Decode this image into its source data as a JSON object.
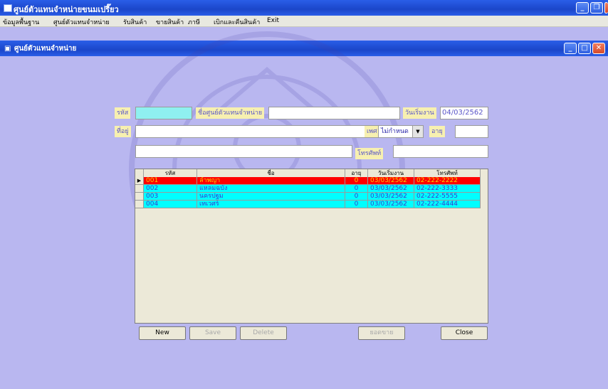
{
  "app": {
    "title": "ศูนย์ตัวแทนจำหน่ายขนมเปรี๊ยว"
  },
  "menu": [
    "ข้อมูลพื้นฐาน",
    "ศูนย์ตัวแทนจำหน่าย",
    "รับสินค้า",
    "ขายสินค้า",
    "ภาษี",
    "เบิกและคืนสินค้า",
    "Exit"
  ],
  "child_window": {
    "title": "ศูนย์ตัวแทนจำหน่าย"
  },
  "form": {
    "code_label": "รหัส",
    "code_value": "",
    "name_label": "ชื่อศูนย์ตัวแทนจำหน่าย",
    "name_value": "",
    "start_label": "วันเริ่มงาน",
    "start_value": "04/03/2562",
    "address_label": "ที่อยู่",
    "address_value": "",
    "address2_value": "",
    "gender_label": "เพศ",
    "gender_value": "ไม่กำหนด",
    "age_label": "อายุ",
    "age_value": "",
    "phone_label": "โทรศัพท์",
    "phone_value": ""
  },
  "grid": {
    "headers": [
      "รหัส",
      "ชื่อ",
      "อายุ",
      "วันเริ่มงาน",
      "โทรศัพท์"
    ],
    "rows": [
      {
        "code": "001",
        "name": "ลำพญา",
        "age": "0",
        "start": "03/03/2562",
        "phone": "02-222-2222"
      },
      {
        "code": "002",
        "name": "แหลมฉบัง",
        "age": "0",
        "start": "03/03/2562",
        "phone": "02-222-3333"
      },
      {
        "code": "003",
        "name": "นครปฐม",
        "age": "0",
        "start": "03/03/2562",
        "phone": "02-222-5555"
      },
      {
        "code": "004",
        "name": "เทเวศร์",
        "age": "0",
        "start": "03/03/2562",
        "phone": "02-222-4444"
      }
    ],
    "selected_marker": "▶"
  },
  "buttons": {
    "new": "New",
    "save": "Save",
    "delete": "Delete",
    "total": "ยอดขาย",
    "close": "Close"
  },
  "colors": {
    "background": "#b9b7f0",
    "selected_row": "#ff0000",
    "row": "#00ffff",
    "title_bar": "#1b46c9"
  }
}
